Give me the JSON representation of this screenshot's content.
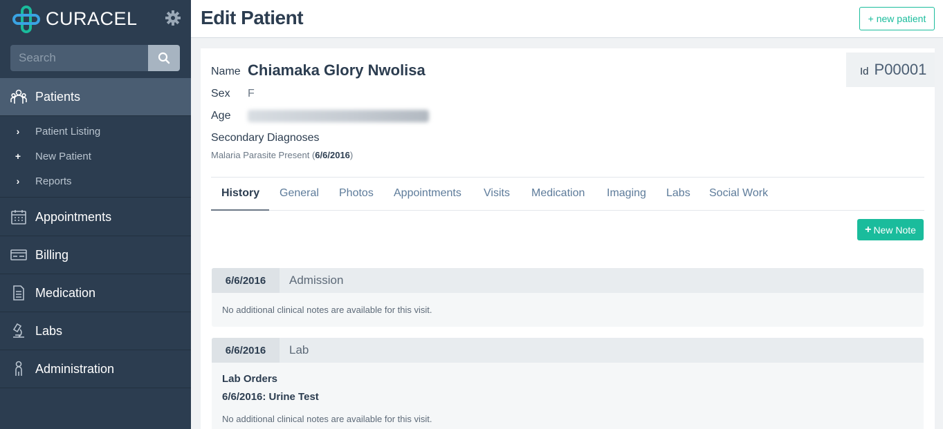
{
  "brand": {
    "name": "CURACEL"
  },
  "search": {
    "placeholder": "Search"
  },
  "nav": {
    "patients": "Patients",
    "sub": [
      {
        "mark": "›",
        "label": "Patient Listing"
      },
      {
        "mark": "+",
        "label": "New Patient"
      },
      {
        "mark": "›",
        "label": "Reports"
      }
    ],
    "appointments": "Appointments",
    "billing": "Billing",
    "medication": "Medication",
    "labs": "Labs",
    "administration": "Administration"
  },
  "header": {
    "title": "Edit Patient",
    "new_patient": "+ new patient"
  },
  "patient": {
    "name_label": "Name",
    "name": "Chiamaka Glory Nwolisa",
    "id_label": "Id",
    "id": "P00001",
    "sex_label": "Sex",
    "sex": "F",
    "age_label": "Age",
    "secondary_label": "Secondary Diagnoses",
    "diagnosis": "Malaria Parasite Present",
    "diagnosis_date": "6/6/2016"
  },
  "tabs": [
    "History",
    "General",
    "Photos",
    "Appointments",
    "Visits",
    "Medication",
    "Imaging",
    "Labs",
    "Social Work"
  ],
  "new_note": "New Note",
  "visits": [
    {
      "date": "6/6/2016",
      "type": "Admission",
      "note": "No additional clinical notes are available for this visit."
    },
    {
      "date": "6/6/2016",
      "type": "Lab",
      "heading": "Lab Orders",
      "order": "6/6/2016: Urine Test",
      "note": "No additional clinical notes are available for this visit."
    }
  ],
  "colors": {
    "sidebar": "#2c3d50",
    "accent": "#1abc9c",
    "active_nav": "#4a5d72"
  }
}
